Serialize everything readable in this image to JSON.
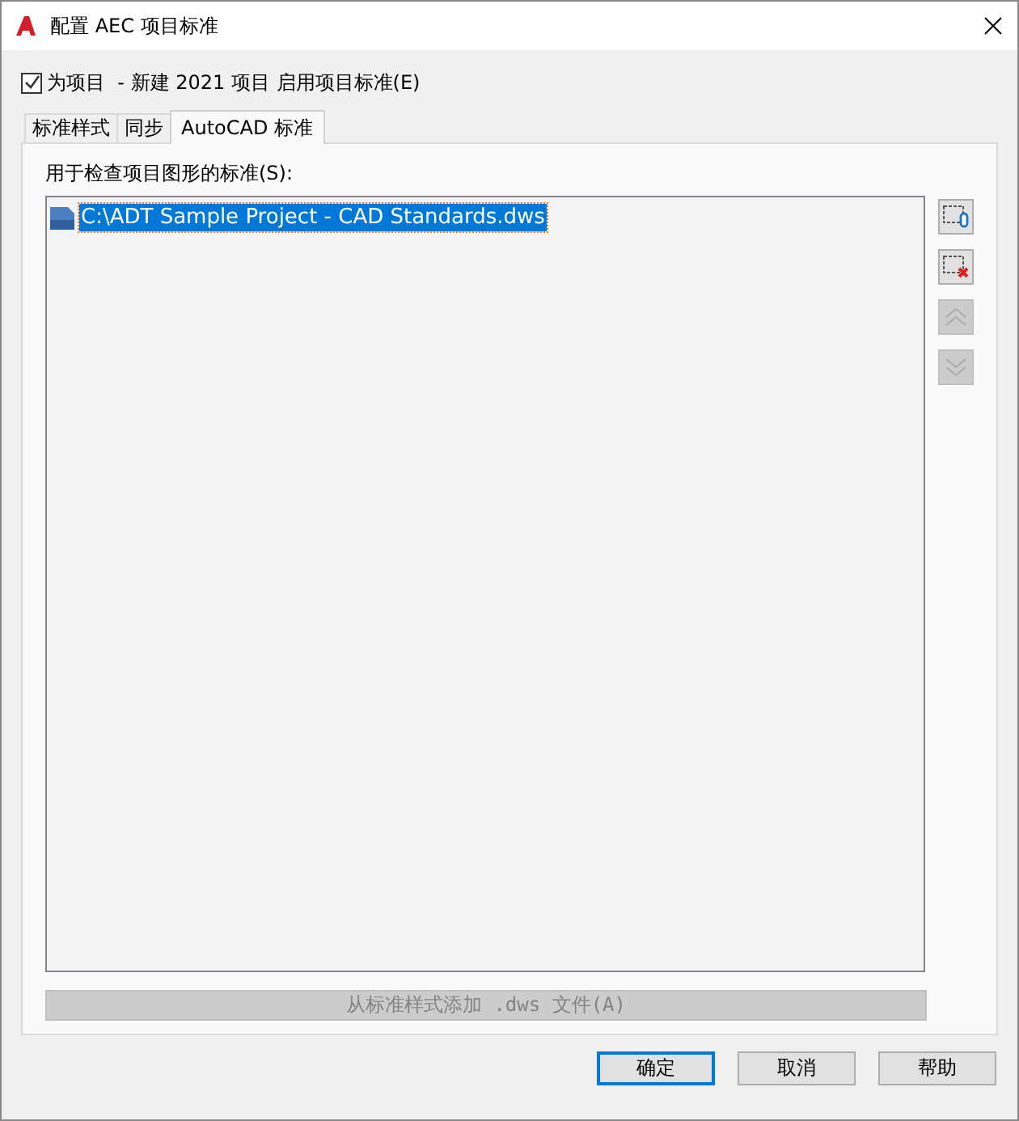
{
  "window": {
    "title": "配置 AEC 项目标准"
  },
  "enable": {
    "label": "为项目  - 新建 2021 项目 启用项目标准(E)",
    "checked": true
  },
  "tabs": [
    {
      "label": "标准样式",
      "selected": false
    },
    {
      "label": "同步",
      "selected": false
    },
    {
      "label": "AutoCAD 标准",
      "selected": true
    }
  ],
  "list": {
    "label": "用于检查项目图形的标准(S):",
    "items": [
      {
        "text": "C:\\ADT Sample Project - CAD Standards.dws",
        "selected": true
      }
    ]
  },
  "side_buttons": [
    {
      "kind": "add",
      "disabled": false
    },
    {
      "kind": "remove",
      "disabled": false
    },
    {
      "kind": "up",
      "disabled": true
    },
    {
      "kind": "down",
      "disabled": true
    }
  ],
  "add_from_styles": {
    "label": "从标准样式添加 .dws 文件(A)",
    "disabled": true
  },
  "buttons": [
    {
      "label": "确定",
      "default": true
    },
    {
      "label": "取消",
      "default": false
    },
    {
      "label": "帮助",
      "default": false
    }
  ]
}
